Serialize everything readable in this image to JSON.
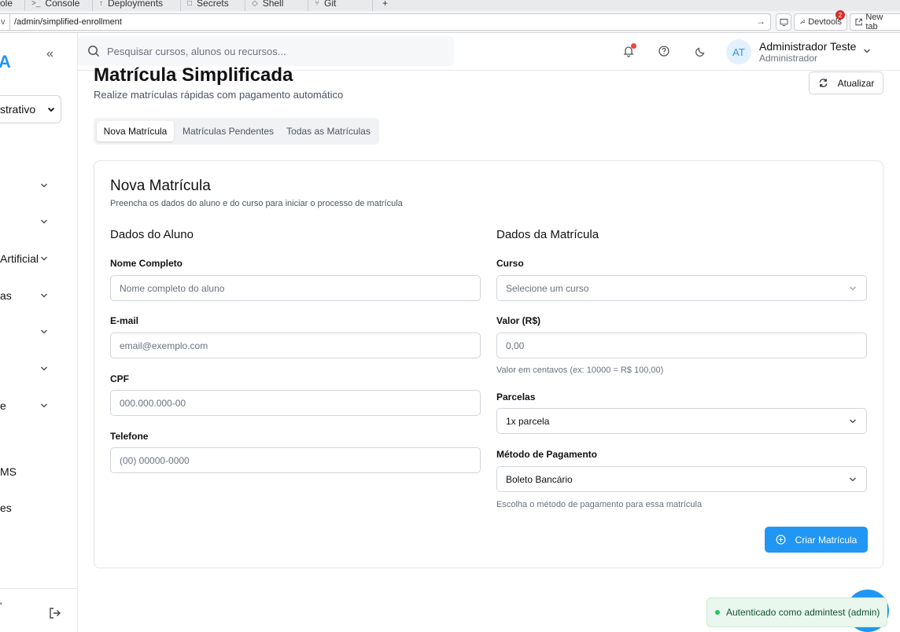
{
  "browser": {
    "tabs": [
      {
        "label": "ole",
        "icon": ""
      },
      {
        "label": "Console",
        "icon": ">_"
      },
      {
        "label": "Deployments",
        "icon": "↑"
      },
      {
        "label": "Secrets",
        "icon": "□"
      },
      {
        "label": "Shell",
        "icon": "◇"
      },
      {
        "label": "Git",
        "icon": "⑂"
      }
    ],
    "new_tab_plus": "+",
    "url_prefix": "v",
    "url": "/admin/simplified-enrollment",
    "devtools_label": "Devtools",
    "devtools_badge": "2",
    "new_tab_label": "New tab"
  },
  "sidebar": {
    "logo_letter": "A",
    "collapse_icon": "«",
    "role_select": "strativo",
    "items": [
      {
        "label": "",
        "has_chevron": true
      },
      {
        "label": "",
        "has_chevron": true
      },
      {
        "label": "Artificial",
        "has_chevron": true
      },
      {
        "label": "as",
        "has_chevron": true
      },
      {
        "label": "",
        "has_chevron": true
      },
      {
        "label": "",
        "has_chevron": true
      },
      {
        "label": "e",
        "has_chevron": true
      },
      {
        "label": "MS",
        "has_chevron": false
      },
      {
        "label": "es",
        "has_chevron": false
      }
    ],
    "footer_char": "'"
  },
  "header": {
    "search_placeholder": "Pesquisar cursos, alunos ou recursos...",
    "user_initials": "AT",
    "user_name": "Administrador Teste",
    "user_role": "Administrador"
  },
  "page": {
    "title": "Matrícula Simplificada",
    "subtitle": "Realize matrículas rápidas com pagamento automático",
    "refresh_label": "Atualizar",
    "tabs": [
      "Nova Matrícula",
      "Matrículas Pendentes",
      "Todas as Matrículas"
    ],
    "active_tab": 0
  },
  "form": {
    "title": "Nova Matrícula",
    "subtitle": "Preencha os dados do aluno e do curso para iniciar o processo de matrícula",
    "student_section": "Dados do Aluno",
    "enrollment_section": "Dados da Matrícula",
    "name_label": "Nome Completo",
    "name_placeholder": "Nome completo do aluno",
    "email_label": "E-mail",
    "email_placeholder": "email@exemplo.com",
    "cpf_label": "CPF",
    "cpf_placeholder": "000.000.000-00",
    "phone_label": "Telefone",
    "phone_placeholder": "(00) 00000-0000",
    "course_label": "Curso",
    "course_placeholder": "Selecione um curso",
    "value_label": "Valor (R$)",
    "value_placeholder": "0,00",
    "value_hint": "Valor em centavos (ex: 10000 = R$ 100,00)",
    "installments_label": "Parcelas",
    "installments_value": "1x parcela",
    "payment_label": "Método de Pagamento",
    "payment_value": "Boleto Bancário",
    "payment_hint": "Escolha o método de pagamento para essa matrícula",
    "submit_label": "Criar Matrícula"
  },
  "toast": {
    "message": "Autenticado como admintest (admin)"
  },
  "colors": {
    "accent": "#2196f3",
    "notification": "#ef4444",
    "success": "#22c55e"
  }
}
